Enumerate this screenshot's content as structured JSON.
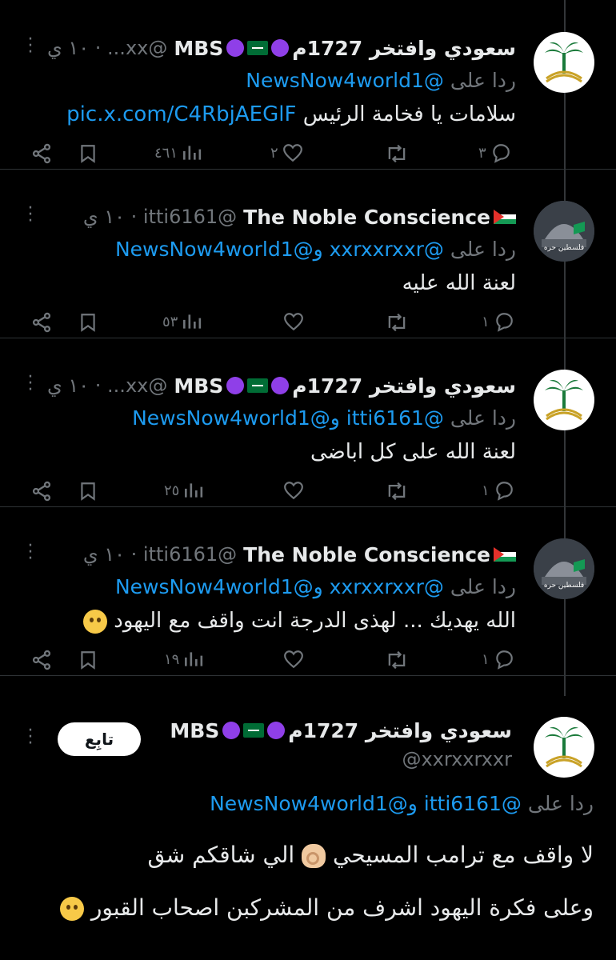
{
  "tweets": [
    {
      "name": "سعودي وافتخر 1727م",
      "suffix": "MBS",
      "handle": "@xx... · ١٠ ي",
      "reply_label": "ردا على",
      "mentions": "@NewsNow4world1",
      "text": "سلامات يا فخامة الرئيس",
      "link": "pic.x.com/C4RbjAEGlF",
      "replies": "٣",
      "retweets": "",
      "likes": "٢",
      "views": "٤٦١"
    },
    {
      "name": "The Noble Conscience",
      "handle": "@itti6161 · ١٠ ي",
      "reply_label": "ردا على",
      "mentions": "@xxrxxrxxr و@NewsNow4world1",
      "text": "لعنة الله عليه",
      "replies": "١",
      "retweets": "",
      "likes": "",
      "views": "٥٣"
    },
    {
      "name": "سعودي وافتخر 1727م",
      "suffix": "MBS",
      "handle": "@xx... · ١٠ ي",
      "reply_label": "ردا على",
      "mentions": "@itti6161 و@NewsNow4world1",
      "text": "لعنة الله على كل اباضى",
      "replies": "١",
      "retweets": "",
      "likes": "",
      "views": "٢٥"
    },
    {
      "name": "The Noble Conscience",
      "handle": "@itti6161 · ١٠ ي",
      "reply_label": "ردا على",
      "mentions": "@xxrxxrxxr و@NewsNow4world1",
      "text": "الله يهديك ... لهذى الدرجة انت واقف مع اليهود",
      "replies": "١",
      "retweets": "",
      "likes": "",
      "views": "١٩"
    }
  ],
  "main_tweet": {
    "name": "سعودي وافتخر 1727م",
    "suffix": "MBS",
    "handle": "@xxrxxrxxr",
    "follow_label": "تابِع",
    "reply_label": "ردا على",
    "mentions": "@itti6161 و@NewsNow4world1",
    "line1": "لا واقف مع ترامب المسيحي",
    "line1b": "الي شاقكم شق",
    "line2": "وعلى فكرة اليهود اشرف من المشركبن اصحاب القبور"
  },
  "colors": {
    "accent": "#1d9bf0",
    "muted": "#71767b",
    "background": "#000000"
  }
}
